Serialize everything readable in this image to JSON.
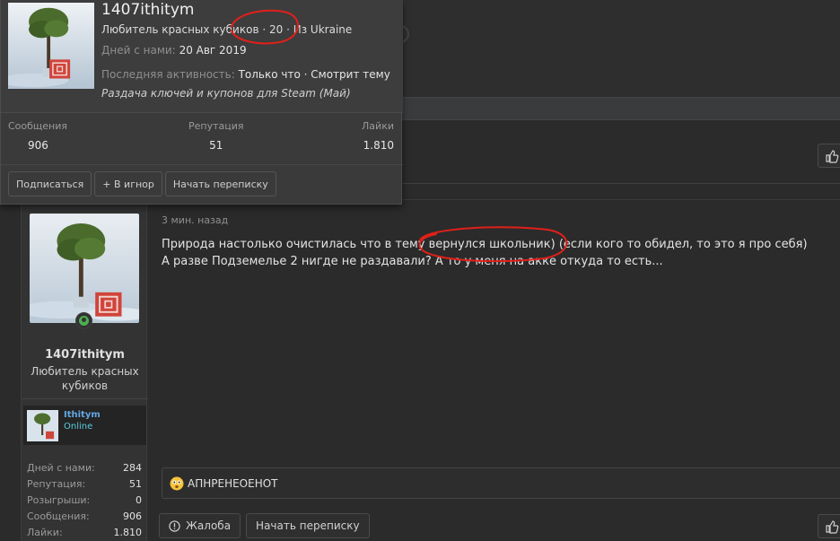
{
  "tooltip": {
    "username": "1407ithitym",
    "user_title": "Любитель красных кубиков",
    "age": "20",
    "location": "Из Ukraine",
    "joined_label": "Дней с нами:",
    "joined_value": "20 Авг 2019",
    "last_activity_label": "Последняя активность:",
    "last_activity_value": "Только что · Смотрит тему",
    "banner": "Раздача ключей и купонов для Steam (Май)",
    "stats": [
      {
        "label": "Сообщения",
        "value": "906"
      },
      {
        "label": "Репутация",
        "value": "51"
      },
      {
        "label": "Лайки",
        "value": "1.810"
      }
    ],
    "buttons": {
      "follow": "Подписаться",
      "ignore": "+ В игнор",
      "message": "Начать переписку"
    }
  },
  "user_panel": {
    "username": "1407ithitym",
    "user_title": "Любитель красных кубиков",
    "steam_name": "Ithitym",
    "steam_status": "Online",
    "stats": [
      {
        "label": "Дней с нами:",
        "value": "284"
      },
      {
        "label": "Репутация:",
        "value": "51"
      },
      {
        "label": "Розыгрыши:",
        "value": "0"
      },
      {
        "label": "Сообщения:",
        "value": "906"
      },
      {
        "label": "Лайки:",
        "value": "1.810"
      }
    ]
  },
  "post": {
    "time": "3 мин. назад",
    "line1": "Природа настолько очистилась что в тему вернулся школьник) (если кого то обидел, то это я про себя)",
    "line2": "А разве Подземелье 2 нигде не раздавали? А то у меня на акке откуда то есть...",
    "signature": "АПНРЕНЕОЕНОТ",
    "actions": {
      "report": "Жалоба",
      "message": "Начать переписку"
    }
  },
  "colors": {
    "background": "#2b2b2b",
    "accent_link": "#62a7e3",
    "online": "#4caf50",
    "annotation": "#e0201a"
  }
}
